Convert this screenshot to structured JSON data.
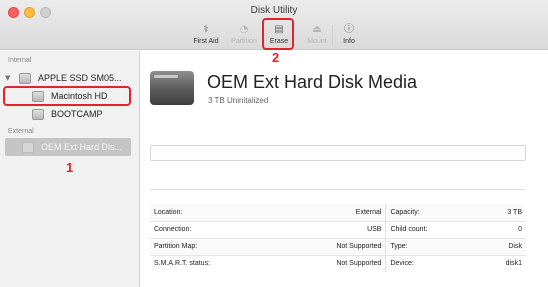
{
  "window": {
    "title": "Disk Utility"
  },
  "toolbar": {
    "first_aid": {
      "label": "First Aid",
      "icon": "stethoscope-icon"
    },
    "partition": {
      "label": "Partition",
      "icon": "pie-icon"
    },
    "erase": {
      "label": "Erase",
      "icon": "erase-icon"
    },
    "mount": {
      "label": "Mount",
      "icon": "mount-icon"
    },
    "info": {
      "label": "Info",
      "icon": "info-icon"
    }
  },
  "sidebar": {
    "internal_header": "Internal",
    "external_header": "External",
    "items": [
      {
        "label": "APPLE SSD SM05..."
      },
      {
        "label": "Macintosh HD"
      },
      {
        "label": "BOOTCAMP"
      },
      {
        "label": "OEM Ext Hard Dis..."
      }
    ]
  },
  "annotations": {
    "step1": "1",
    "step2": "2",
    "highlight_color": "#e0242b"
  },
  "main": {
    "title": "OEM Ext Hard Disk Media",
    "subtitle": "3 TB Uninitalized",
    "info_rows": [
      {
        "label_left": "Location:",
        "value_left": "External",
        "label_right": "Capacity:",
        "value_right": "3 TB"
      },
      {
        "label_left": "Connection:",
        "value_left": "USB",
        "label_right": "Child count:",
        "value_right": "0"
      },
      {
        "label_left": "Partition Map:",
        "value_left": "Not Supported",
        "label_right": "Type:",
        "value_right": "Disk"
      },
      {
        "label_left": "S.M.A.R.T. status:",
        "value_left": "Not Supported",
        "label_right": "Device:",
        "value_right": "disk1"
      }
    ]
  }
}
